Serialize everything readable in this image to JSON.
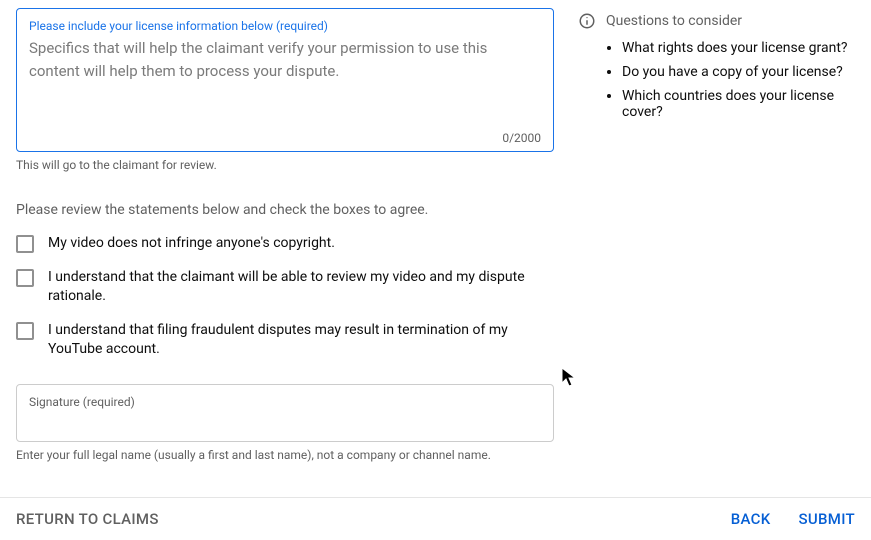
{
  "license_box": {
    "label": "Please include your license information below (required)",
    "placeholder": "Specifics that will help the claimant verify your permission to use this content will help them to process your dispute.",
    "char_count": "0/2000",
    "helper": "This will go to the claimant for review."
  },
  "statements": {
    "intro": "Please review the statements below and check the boxes to agree.",
    "items": [
      "My video does not infringe anyone's copyright.",
      "I understand that the claimant will be able to review my video and my dispute rationale.",
      "I understand that filing fraudulent disputes may result in termination of my YouTube account."
    ]
  },
  "signature": {
    "label": "Signature (required)",
    "helper": "Enter your full legal name (usually a first and last name), not a company or channel name."
  },
  "sidebar": {
    "heading": "Questions to consider",
    "items": [
      "What rights does your license grant?",
      "Do you have a copy of your license?",
      "Which countries does your license cover?"
    ]
  },
  "footer": {
    "return": "RETURN TO CLAIMS",
    "back": "BACK",
    "submit": "SUBMIT"
  }
}
